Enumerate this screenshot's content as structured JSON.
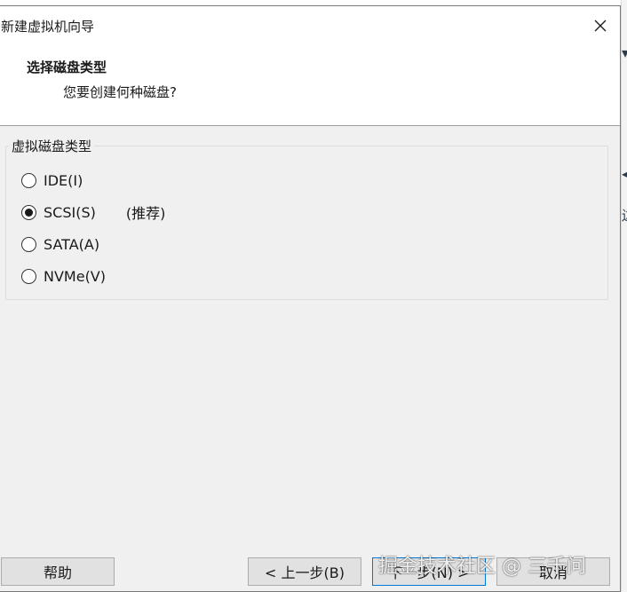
{
  "window": {
    "title": "新建虚拟机向导"
  },
  "header": {
    "title": "选择磁盘类型",
    "subtitle": "您要创建何种磁盘?"
  },
  "group": {
    "label": "虚拟磁盘类型",
    "options": [
      {
        "label": "IDE(I)",
        "checked": false,
        "note": ""
      },
      {
        "label": "SCSI(S)",
        "checked": true,
        "note": "(推荐)"
      },
      {
        "label": "SATA(A)",
        "checked": false,
        "note": ""
      },
      {
        "label": "NVMe(V)",
        "checked": false,
        "note": ""
      }
    ]
  },
  "buttons": {
    "help": "帮助",
    "back": "< 上一步(B)",
    "next": "下一步(N) >",
    "cancel": "取消"
  },
  "background": {
    "glyph_1": "▾",
    "glyph_2": "◀",
    "glyph_3": "边"
  },
  "watermark": "掘金技术社区 @ 三千问",
  "colors": {
    "accent": "#0078d7",
    "dialog_bg": "#f0f0f0",
    "button_bg": "#e1e1e1"
  }
}
